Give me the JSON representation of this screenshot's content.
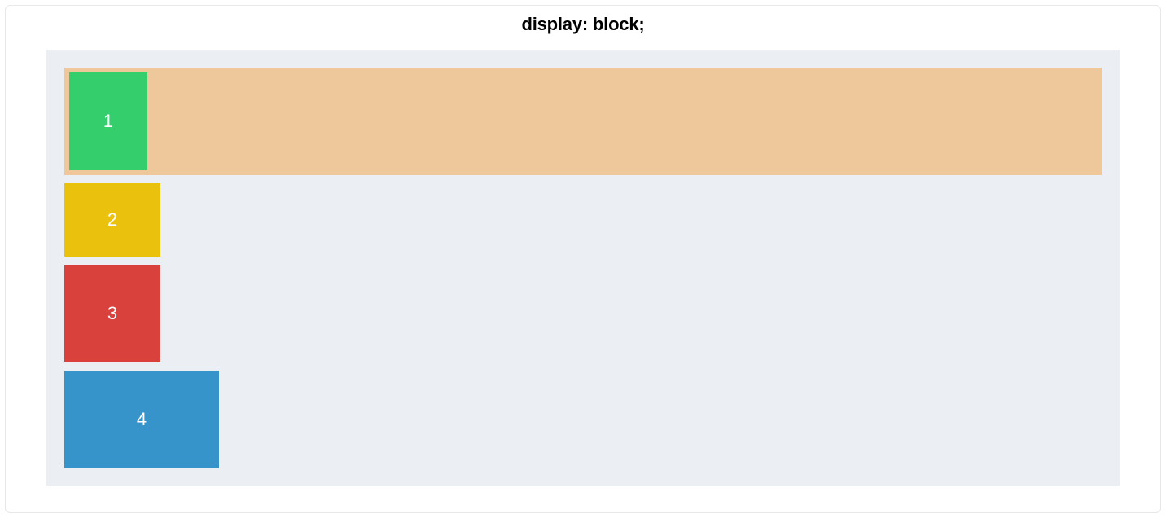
{
  "title": "display: block;",
  "boxes": [
    {
      "label": "1",
      "color": "#35ce6d",
      "highlighted": true
    },
    {
      "label": "2",
      "color": "#eac20d",
      "highlighted": false
    },
    {
      "label": "3",
      "color": "#d8413c",
      "highlighted": false
    },
    {
      "label": "4",
      "color": "#3794cb",
      "highlighted": false
    }
  ],
  "colors": {
    "stage_bg": "#ebeef2",
    "highlight_bg": "#eec89a"
  }
}
